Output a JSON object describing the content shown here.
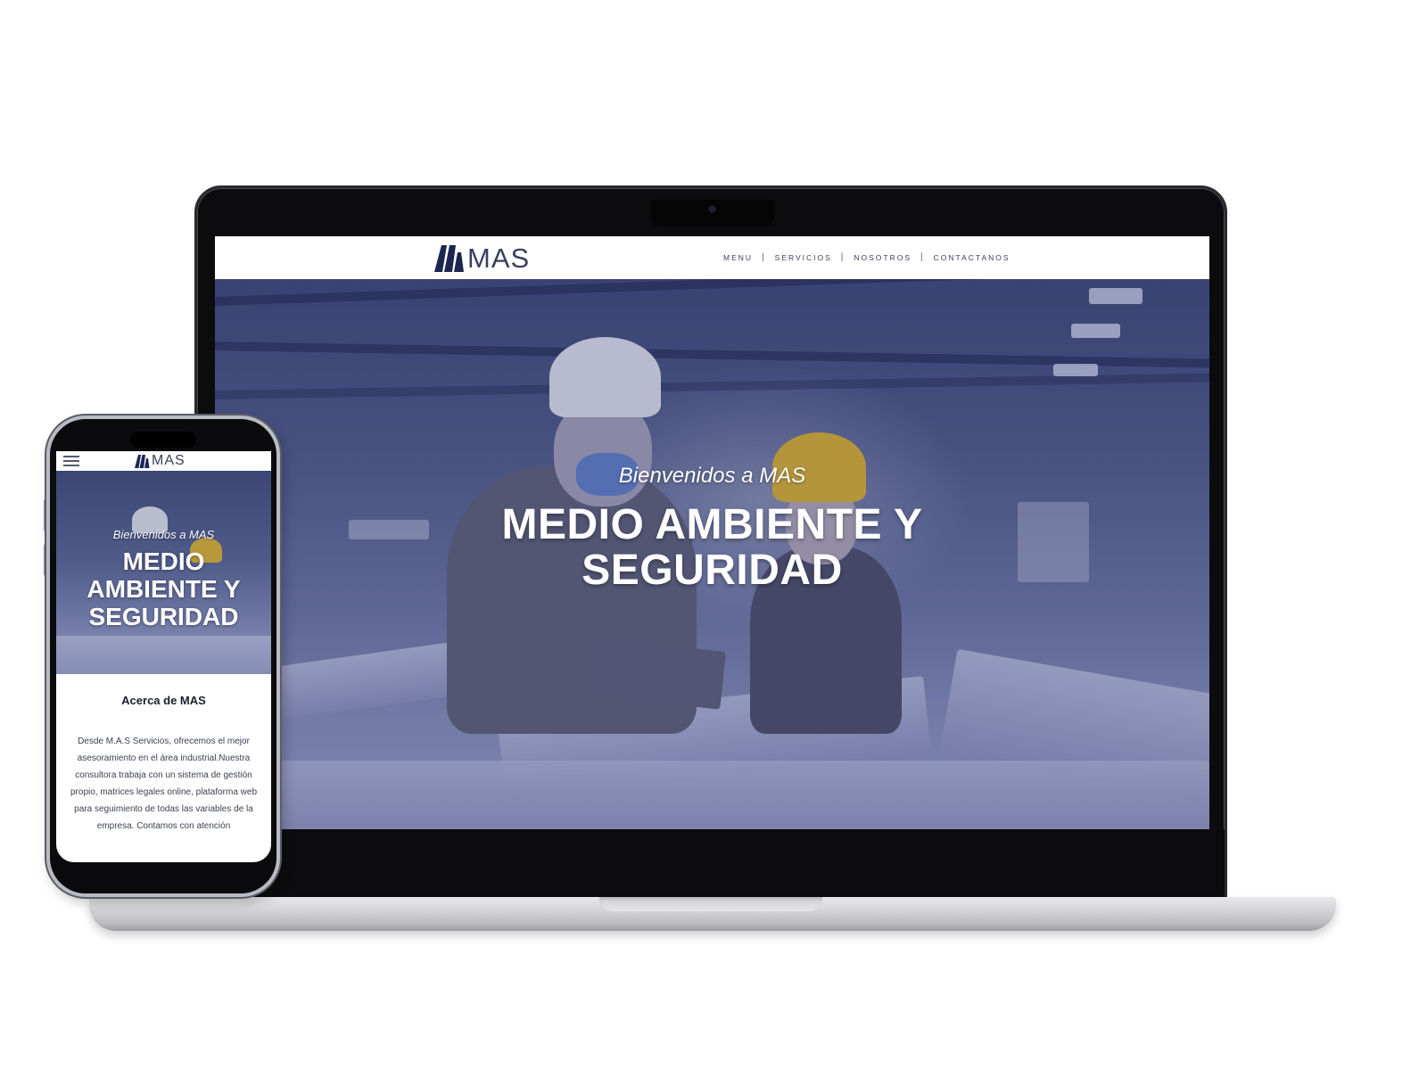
{
  "brand": {
    "logo_text": "MAS",
    "colors": {
      "navy": "#1c2550",
      "hero_tint": "#4a5680",
      "white": "#ffffff"
    }
  },
  "laptop": {
    "nav": [
      {
        "label": "MENU"
      },
      {
        "label": "SERVICIOS"
      },
      {
        "label": "NOSOTROS"
      },
      {
        "label": "CONTACTANOS"
      }
    ],
    "hero": {
      "subtitle": "Bienvenidos a MAS",
      "title_line1": "MEDIO AMBIENTE Y",
      "title_line2": "SEGURIDAD"
    }
  },
  "phone": {
    "menu_icon": "hamburger-icon",
    "hero": {
      "subtitle": "Bienvenidos a MAS",
      "title_line1": "MEDIO",
      "title_line2": "AMBIENTE Y",
      "title_line3": "SEGURIDAD"
    },
    "about": {
      "title": "Acerca de MAS",
      "text": "Desde M.A.S Servicios, ofrecemos el mejor asesoramiento en el área industrial.Nuestra consultora trabaja con un sistema de gestión propio, matrices legales online, plataforma web para seguimiento de todas las variables de la empresa. Contamos con atención"
    }
  }
}
